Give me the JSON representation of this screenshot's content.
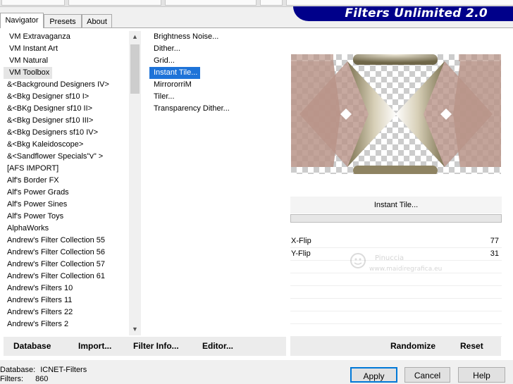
{
  "header": {
    "title": "Filters Unlimited 2.0"
  },
  "tabs": [
    {
      "label": "Navigator",
      "active": true
    },
    {
      "label": "Presets",
      "active": false
    },
    {
      "label": "About",
      "active": false
    }
  ],
  "categories": [
    "VM Extravaganza",
    "VM Instant Art",
    "VM Natural",
    "VM Toolbox",
    "&<Background Designers IV>",
    "&<Bkg Designer sf10 I>",
    "&<BKg Designer sf10 II>",
    "&<Bkg Designer sf10 III>",
    "&<Bkg Designers sf10 IV>",
    "&<Bkg Kaleidoscope>",
    "&<Sandflower Specials\"v\" >",
    "[AFS IMPORT]",
    "Alf's Border FX",
    "Alf's Power Grads",
    "Alf's Power Sines",
    "Alf's Power Toys",
    "AlphaWorks",
    "Andrew's Filter Collection 55",
    "Andrew's Filter Collection 56",
    "Andrew's Filter Collection 57",
    "Andrew's Filter Collection 61",
    "Andrew's Filters 10",
    "Andrew's Filters 11",
    "Andrew's Filters 22",
    "Andrew's Filters 2"
  ],
  "selected_category": "VM Toolbox",
  "filters": [
    "Brightness Noise...",
    "Dither...",
    "Grid...",
    "Instant Tile...",
    "MirrororriM",
    "Tiler...",
    "Transparency Dither..."
  ],
  "selected_filter": "Instant Tile...",
  "current_filter_name": "Instant Tile...",
  "params": [
    {
      "label": "X-Flip",
      "value": "77"
    },
    {
      "label": "Y-Flip",
      "value": "31"
    }
  ],
  "bottom_left_buttons": {
    "database": "Database",
    "import": "Import...",
    "filter_info": "Filter Info...",
    "editor": "Editor..."
  },
  "bottom_right_buttons": {
    "randomize": "Randomize",
    "reset": "Reset"
  },
  "status": {
    "database_label": "Database:",
    "database_value": "ICNET-Filters",
    "filters_label": "Filters:",
    "filters_value": "860"
  },
  "dialog_buttons": {
    "apply": "Apply",
    "cancel": "Cancel",
    "help": "Help"
  },
  "colors": {
    "banner": "#00008a",
    "selection": "#1e73d8",
    "preview_rose": "#b99488",
    "preview_gold": "#8e8362"
  }
}
